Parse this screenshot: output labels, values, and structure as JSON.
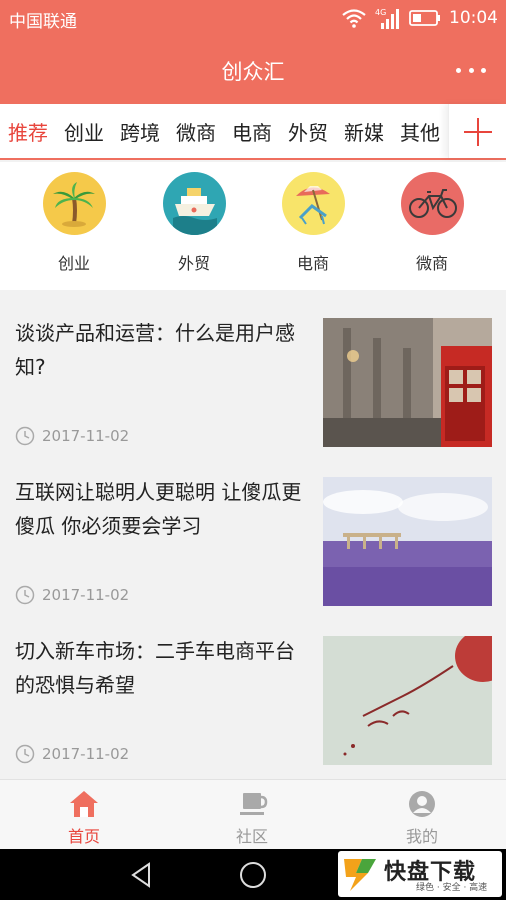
{
  "status_bar": {
    "carrier": "中国联通",
    "network": "4G",
    "time": "10:04"
  },
  "header": {
    "title": "创众汇",
    "more_icon": "more-dots-icon"
  },
  "tabs": [
    {
      "label": "推荐",
      "active": true
    },
    {
      "label": "创业"
    },
    {
      "label": "跨境"
    },
    {
      "label": "微商"
    },
    {
      "label": "电商"
    },
    {
      "label": "外贸"
    },
    {
      "label": "新媒"
    },
    {
      "label": "其他"
    }
  ],
  "add_tab_icon": "plus-icon",
  "quick_categories": [
    {
      "label": "创业",
      "icon": "palm-tree-icon",
      "color": "#f5c94a"
    },
    {
      "label": "外贸",
      "icon": "ship-icon",
      "color": "#2fa6b3"
    },
    {
      "label": "电商",
      "icon": "beach-chair-icon",
      "color": "#f8e46a"
    },
    {
      "label": "微商",
      "icon": "bicycle-icon",
      "color": "#e96b66"
    }
  ],
  "articles": [
    {
      "title": "谈谈产品和运营：什么是用户感知?",
      "date": "2017-11-02"
    },
    {
      "title": "互联网让聪明人更聪明 让傻瓜更傻瓜 你必须要会学习",
      "date": "2017-11-02"
    },
    {
      "title": "切入新车市场：二手车电商平台的恐惧与希望",
      "date": "2017-11-02"
    }
  ],
  "bottom_nav": [
    {
      "label": "首页",
      "icon": "home-icon",
      "active": true
    },
    {
      "label": "社区",
      "icon": "coffee-cup-icon"
    },
    {
      "label": "我的",
      "icon": "user-icon"
    }
  ],
  "watermark": {
    "main": "快盘下载",
    "sub": "绿色 · 安全 · 高速"
  },
  "colors": {
    "brand": "#ef6f5f",
    "active": "#e8453c",
    "muted": "#999999"
  }
}
